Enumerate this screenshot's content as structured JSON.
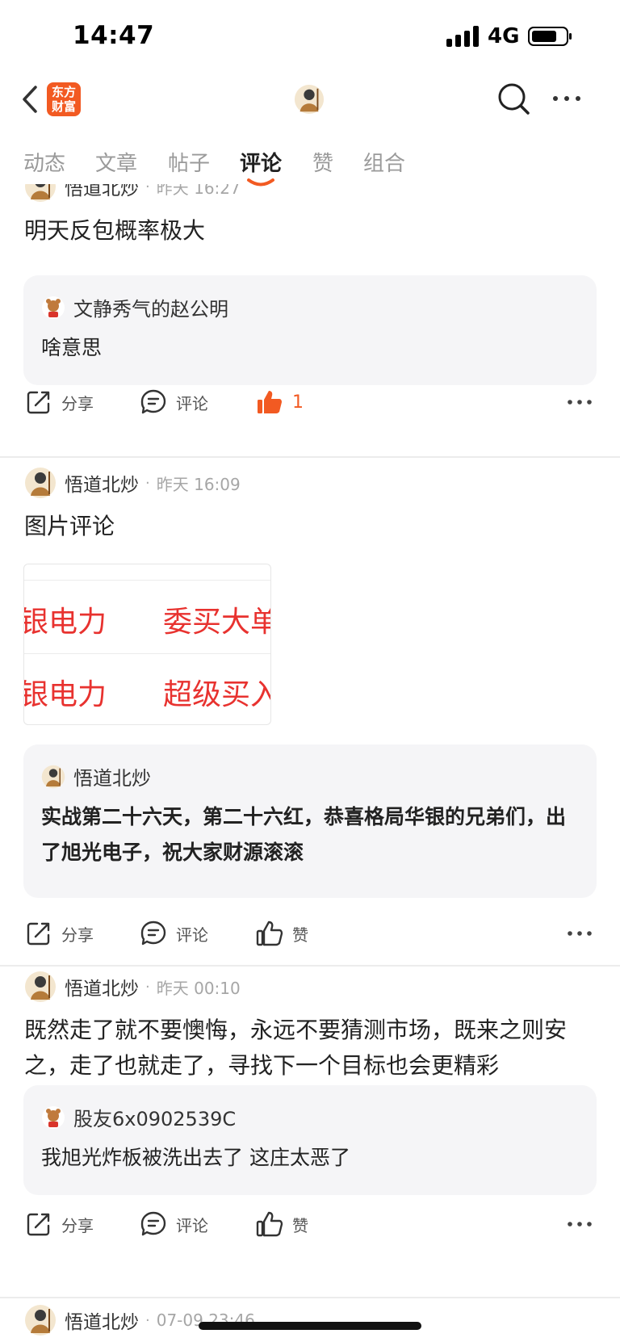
{
  "status": {
    "time": "14:47",
    "network": "4G"
  },
  "header": {
    "logo_line1": "东方",
    "logo_line2": "财富"
  },
  "tabs": [
    {
      "label": "动态"
    },
    {
      "label": "文章"
    },
    {
      "label": "帖子"
    },
    {
      "label": "评论"
    },
    {
      "label": "赞"
    },
    {
      "label": "组合"
    }
  ],
  "posts": [
    {
      "author": "悟道北炒",
      "time": "昨天 16:27",
      "text": "明天反包概率极大",
      "quote": {
        "author": "文静秀气的赵公明",
        "text": "啥意思"
      },
      "share": "分享",
      "comment": "评论",
      "like": "1"
    },
    {
      "author": "悟道北炒",
      "time": "昨天 16:09",
      "text": "图片评论",
      "image": {
        "cells": [
          "银电力",
          "委买大单",
          "银电力",
          "超级买入"
        ]
      },
      "quote": {
        "author": "悟道北炒",
        "text": "实战第二十六天，第二十六红，恭喜格局华银的兄弟们，出了旭光电子，祝大家财源滚滚"
      },
      "share": "分享",
      "comment": "评论",
      "like": "赞"
    },
    {
      "author": "悟道北炒",
      "time": "昨天 00:10",
      "text": "既然走了就不要懊悔，永远不要猜测市场，既来之则安之，走了也就走了，寻找下一个目标也会更精彩",
      "quote": {
        "author": "股友6x0902539C",
        "text": "我旭光炸板被洗出去了 这庄太恶了"
      },
      "share": "分享",
      "comment": "评论",
      "like": "赞"
    },
    {
      "author": "悟道北炒",
      "time": "07-09 23:46"
    }
  ],
  "colors": {
    "accent": "#f25a22",
    "image_text": "#e8322f",
    "card_bg": "#f5f5f7"
  }
}
